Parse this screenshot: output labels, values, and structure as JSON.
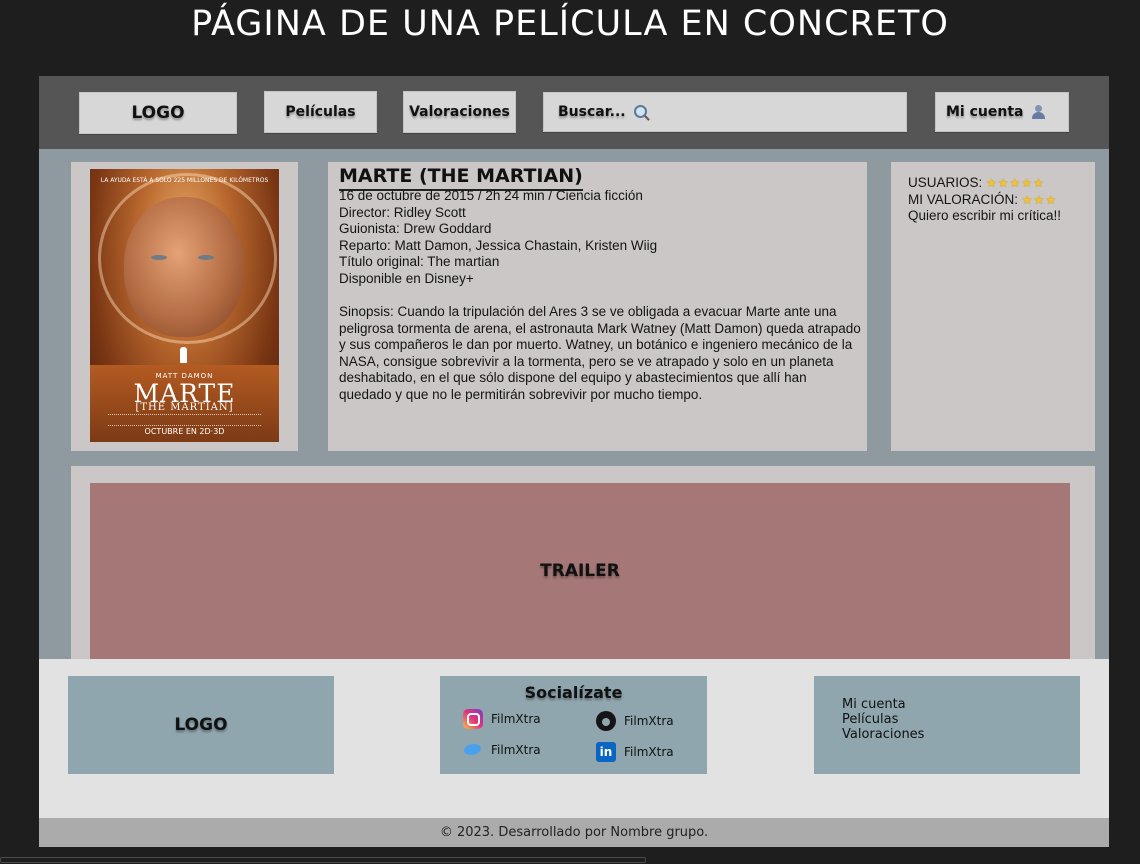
{
  "page": {
    "heading": "PÁGINA DE UNA PELÍCULA EN CONCRETO"
  },
  "nav": {
    "logo": "LOGO",
    "peliculas": "Películas",
    "valoraciones": "Valoraciones",
    "search_label": "Buscar...",
    "search_icon": "search-icon",
    "account": "Mi cuenta",
    "account_icon": "user-icon"
  },
  "poster": {
    "tagline": "LA AYUDA ESTÁ A SOLO 225 MILLONES DE KILÓMETROS",
    "actor": "MATT DAMON",
    "title": "MARTE",
    "subtitle": "[THE MARTIAN]",
    "date": "OCTUBRE EN 2D·3D"
  },
  "movie": {
    "title": "MARTE (THE MARTIAN)",
    "meta": "16 de octubre de 2015 / 2h 24 min / Ciencia ficción",
    "director": "Director: Ridley Scott",
    "writer": "Guionista: Drew Goddard",
    "cast": "Reparto: Matt Damon, Jessica Chastain, Kristen Wiig",
    "original_title": "Título original: The martian",
    "availability": "Disponible en Disney+",
    "synopsis": "Sinopsis: Cuando la tripulación del Ares 3 se ve obligada a evacuar Marte ante una peligrosa tormenta de arena, el astronauta Mark Watney (Matt Damon) queda atrapado y sus compañeros le dan por muerto. Watney, un botánico e ingeniero mecánico de la NASA, consigue sobrevivir a la tormenta, pero se ve atrapado y solo en un planeta deshabitado, en el que sólo dispone del equipo y abastecimientos que allí han quedado y que no le permitirán sobrevivir por mucho tiempo."
  },
  "ratings": {
    "users_label": "USUARIOS:",
    "users_stars": "★★★★★",
    "users_value": 5,
    "mine_label": "MI VALORACIÓN:",
    "mine_stars": "★★★",
    "mine_value": 3,
    "write_review": "Quiero escribir mi crítica!!"
  },
  "trailer": {
    "label": "TRAILER"
  },
  "footer": {
    "logo": "LOGO",
    "social_title": "Socialízate",
    "social": [
      {
        "icon": "instagram-icon",
        "label": "FilmXtra"
      },
      {
        "icon": "github-icon",
        "label": "FilmXtra"
      },
      {
        "icon": "twitter-icon",
        "label": "FilmXtra"
      },
      {
        "icon": "linkedin-icon",
        "label": "FilmXtra"
      }
    ],
    "links": [
      "Mi cuenta",
      "Películas",
      "Valoraciones"
    ],
    "copyright": "© 2023. Desarrollado por Nombre grupo."
  },
  "colors": {
    "background": "#1e1e1e",
    "navbar": "#555555",
    "content": "#8e9aa0",
    "card": "#cac7c6",
    "trailer": "#a57877",
    "footer_box": "#8fa6ae",
    "stars": "#f1c232"
  }
}
